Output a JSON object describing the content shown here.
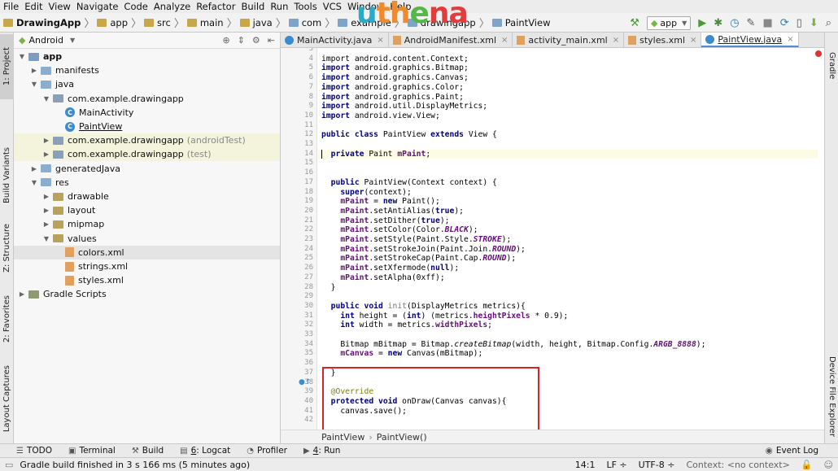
{
  "menu": [
    "File",
    "Edit",
    "View",
    "Navigate",
    "Code",
    "Analyze",
    "Refactor",
    "Build",
    "Run",
    "Tools",
    "VCS",
    "Window",
    "Help"
  ],
  "breadcrumb": {
    "items": [
      "DrawingApp",
      "app",
      "src",
      "main",
      "java",
      "com",
      "example",
      "drawingapp",
      "PaintView"
    ]
  },
  "watermark": [
    "u",
    "th",
    "e",
    "na"
  ],
  "toolbar": {
    "run_config": "app"
  },
  "left_tool_windows": [
    "1: Project",
    "Build Variants",
    "Z: Structure",
    "2: Favorites",
    "Layout Captures"
  ],
  "right_tool_windows": [
    "Gradle",
    "Device File Explorer"
  ],
  "project_panel": {
    "view_mode": "Android",
    "tree": [
      {
        "label": "app",
        "kind": "module",
        "level": 0,
        "expanded": true
      },
      {
        "label": "manifests",
        "kind": "folder",
        "level": 1,
        "expanded": false
      },
      {
        "label": "java",
        "kind": "folder",
        "level": 1,
        "expanded": true
      },
      {
        "label": "com.example.drawingapp",
        "kind": "package",
        "level": 2,
        "expanded": true
      },
      {
        "label": "MainActivity",
        "kind": "class",
        "level": 3
      },
      {
        "label": "PaintView",
        "kind": "class",
        "level": 3,
        "underline": true
      },
      {
        "label": "com.example.drawingapp",
        "suffix": "(androidTest)",
        "kind": "package",
        "level": 2,
        "expanded": false,
        "highlight": true
      },
      {
        "label": "com.example.drawingapp",
        "suffix": "(test)",
        "kind": "package",
        "level": 2,
        "expanded": false,
        "highlight": true
      },
      {
        "label": "generatedJava",
        "kind": "folder",
        "level": 1,
        "expanded": false
      },
      {
        "label": "res",
        "kind": "folder",
        "level": 1,
        "expanded": true
      },
      {
        "label": "drawable",
        "kind": "res",
        "level": 2,
        "expanded": false
      },
      {
        "label": "layout",
        "kind": "res",
        "level": 2,
        "expanded": false
      },
      {
        "label": "mipmap",
        "kind": "res",
        "level": 2,
        "expanded": false
      },
      {
        "label": "values",
        "kind": "res",
        "level": 2,
        "expanded": true
      },
      {
        "label": "colors.xml",
        "kind": "xml",
        "level": 3,
        "selected": true
      },
      {
        "label": "strings.xml",
        "kind": "xml",
        "level": 3
      },
      {
        "label": "styles.xml",
        "kind": "xml",
        "level": 3
      },
      {
        "label": "Gradle Scripts",
        "kind": "gradle",
        "level": 0,
        "expanded": false
      }
    ]
  },
  "editor_tabs": [
    {
      "label": "MainActivity.java",
      "icon": "class",
      "active": false
    },
    {
      "label": "AndroidManifest.xml",
      "icon": "xml",
      "active": false
    },
    {
      "label": "activity_main.xml",
      "icon": "xml",
      "active": false
    },
    {
      "label": "styles.xml",
      "icon": "xml",
      "active": false
    },
    {
      "label": "PaintView.java",
      "icon": "class",
      "active": true
    }
  ],
  "editor": {
    "first_line": 4,
    "current_line": 14,
    "lines": [
      [
        [
          "import android.content.Context;",
          "kw0"
        ]
      ],
      [
        [
          "import",
          "kw"
        ],
        [
          " android.graphics.Bitmap;",
          ""
        ]
      ],
      [
        [
          "import",
          "kw"
        ],
        [
          " android.graphics.Canvas;",
          ""
        ]
      ],
      [
        [
          "import",
          "kw"
        ],
        [
          " android.graphics.Color;",
          ""
        ]
      ],
      [
        [
          "import",
          "kw"
        ],
        [
          " android.graphics.Paint;",
          ""
        ]
      ],
      [
        [
          "import",
          "kw"
        ],
        [
          " android.util.DisplayMetrics;",
          ""
        ]
      ],
      [
        [
          "import",
          "kw"
        ],
        [
          " android.view.View;",
          ""
        ]
      ],
      [],
      [
        [
          "public class",
          "kw"
        ],
        [
          " PaintView ",
          ""
        ],
        [
          "extends",
          "kw"
        ],
        [
          " View {",
          ""
        ]
      ],
      [],
      [
        [
          "  ",
          ""
        ],
        [
          "private",
          "kw"
        ],
        [
          " Paint ",
          ""
        ],
        [
          "mPaint",
          "fld"
        ],
        [
          ";",
          ""
        ]
      ],
      [],
      [],
      [
        [
          "  ",
          ""
        ],
        [
          "public",
          "kw"
        ],
        [
          " PaintView(Context context) {",
          ""
        ]
      ],
      [
        [
          "    ",
          ""
        ],
        [
          "super",
          "kw"
        ],
        [
          "(context);",
          ""
        ]
      ],
      [
        [
          "    ",
          ""
        ],
        [
          "mPaint",
          "fld"
        ],
        [
          " = ",
          ""
        ],
        [
          "new",
          "kw"
        ],
        [
          " Paint();",
          ""
        ]
      ],
      [
        [
          "    ",
          ""
        ],
        [
          "mPaint",
          "fld"
        ],
        [
          ".setAntiAlias(",
          ""
        ],
        [
          "true",
          "kw"
        ],
        [
          ");",
          ""
        ]
      ],
      [
        [
          "    ",
          ""
        ],
        [
          "mPaint",
          "fld"
        ],
        [
          ".setDither(",
          ""
        ],
        [
          "true",
          "kw"
        ],
        [
          ");",
          ""
        ]
      ],
      [
        [
          "    ",
          ""
        ],
        [
          "mPaint",
          "fld"
        ],
        [
          ".setColor(Color.",
          ""
        ],
        [
          "BLACK",
          "fldi"
        ],
        [
          ");",
          ""
        ]
      ],
      [
        [
          "    ",
          ""
        ],
        [
          "mPaint",
          "fld"
        ],
        [
          ".setStyle(Paint.Style.",
          ""
        ],
        [
          "STROKE",
          "fldi"
        ],
        [
          ");",
          ""
        ]
      ],
      [
        [
          "    ",
          ""
        ],
        [
          "mPaint",
          "fld"
        ],
        [
          ".setStrokeJoin(Paint.Join.",
          ""
        ],
        [
          "ROUND",
          "fldi"
        ],
        [
          ");",
          ""
        ]
      ],
      [
        [
          "    ",
          ""
        ],
        [
          "mPaint",
          "fld"
        ],
        [
          ".setStrokeCap(Paint.Cap.",
          ""
        ],
        [
          "ROUND",
          "fldi"
        ],
        [
          ");",
          ""
        ]
      ],
      [
        [
          "    ",
          ""
        ],
        [
          "mPaint",
          "fld"
        ],
        [
          ".setXfermode(",
          ""
        ],
        [
          "null",
          "kw"
        ],
        [
          ");",
          ""
        ]
      ],
      [
        [
          "    ",
          ""
        ],
        [
          "mPaint",
          "fld"
        ],
        [
          ".setAlpha(0xff);",
          ""
        ]
      ],
      [
        [
          "  }",
          ""
        ]
      ],
      [],
      [
        [
          "  ",
          ""
        ],
        [
          "public void",
          "kw"
        ],
        [
          " ",
          ""
        ],
        [
          "init",
          "mth"
        ],
        [
          "(DisplayMetrics metrics){",
          ""
        ]
      ],
      [
        [
          "    ",
          ""
        ],
        [
          "int",
          "kw"
        ],
        [
          " height = (",
          ""
        ],
        [
          "int",
          "kw"
        ],
        [
          ") (metrics.",
          ""
        ],
        [
          "heightPixels",
          "fld"
        ],
        [
          " * 0.9);",
          ""
        ]
      ],
      [
        [
          "    ",
          ""
        ],
        [
          "int",
          "kw"
        ],
        [
          " width = metrics.",
          ""
        ],
        [
          "widthPixels",
          "fld"
        ],
        [
          ";",
          ""
        ]
      ],
      [],
      [
        [
          "    Bitmap mBitmap = Bitmap.",
          ""
        ],
        [
          "createBitmap",
          "st"
        ],
        [
          "(width, height, Bitmap.Config.",
          ""
        ],
        [
          "ARGB_8888",
          "fldi"
        ],
        [
          ");",
          ""
        ]
      ],
      [
        [
          "    ",
          ""
        ],
        [
          "mCanvas",
          "fld"
        ],
        [
          " = ",
          ""
        ],
        [
          "new",
          "kw"
        ],
        [
          " Canvas(mBitmap);",
          ""
        ]
      ],
      [],
      [
        [
          "  }",
          ""
        ]
      ],
      [],
      [
        [
          "  ",
          ""
        ],
        [
          "@Override",
          "ann"
        ]
      ],
      [
        [
          "  ",
          ""
        ],
        [
          "protected void",
          "kw"
        ],
        [
          " onDraw(Canvas canvas){",
          ""
        ]
      ],
      [
        [
          "    canvas.save();",
          ""
        ]
      ],
      [],
      [],
      [
        [
          "  }",
          ""
        ]
      ]
    ],
    "line_numbers": [
      "3",
      "4",
      "5",
      "6",
      "7",
      "8",
      "9",
      "10",
      "11",
      "12",
      "13",
      "14",
      "15",
      "16",
      "17",
      "18",
      "19",
      "20",
      "21",
      "22",
      "23",
      "24",
      "25",
      "26",
      "27",
      "28",
      "29",
      "30",
      "31",
      "32",
      "33",
      "34",
      "35",
      "36",
      "37",
      "38",
      "39",
      "40",
      "41",
      "42"
    ],
    "breadcrumb": [
      "PaintView",
      "PaintView()"
    ]
  },
  "bottom_tabs": [
    {
      "num": "",
      "label": "TODO",
      "icon": "☰"
    },
    {
      "num": "",
      "label": "Terminal",
      "icon": "▣"
    },
    {
      "num": "",
      "label": "Build",
      "icon": "⚒"
    },
    {
      "num": "6",
      "label": ": Logcat",
      "icon": "▤"
    },
    {
      "num": "",
      "label": "Profiler",
      "icon": "◔"
    },
    {
      "num": "4",
      "label": ": Run",
      "icon": "▶"
    }
  ],
  "event_log": "Event Log",
  "status": {
    "message": "Gradle build finished in 3 s 166 ms (5 minutes ago)",
    "position": "14:1",
    "line_sep": "LF ÷",
    "encoding": "UTF-8 ÷",
    "context": "Context: <no context>"
  }
}
